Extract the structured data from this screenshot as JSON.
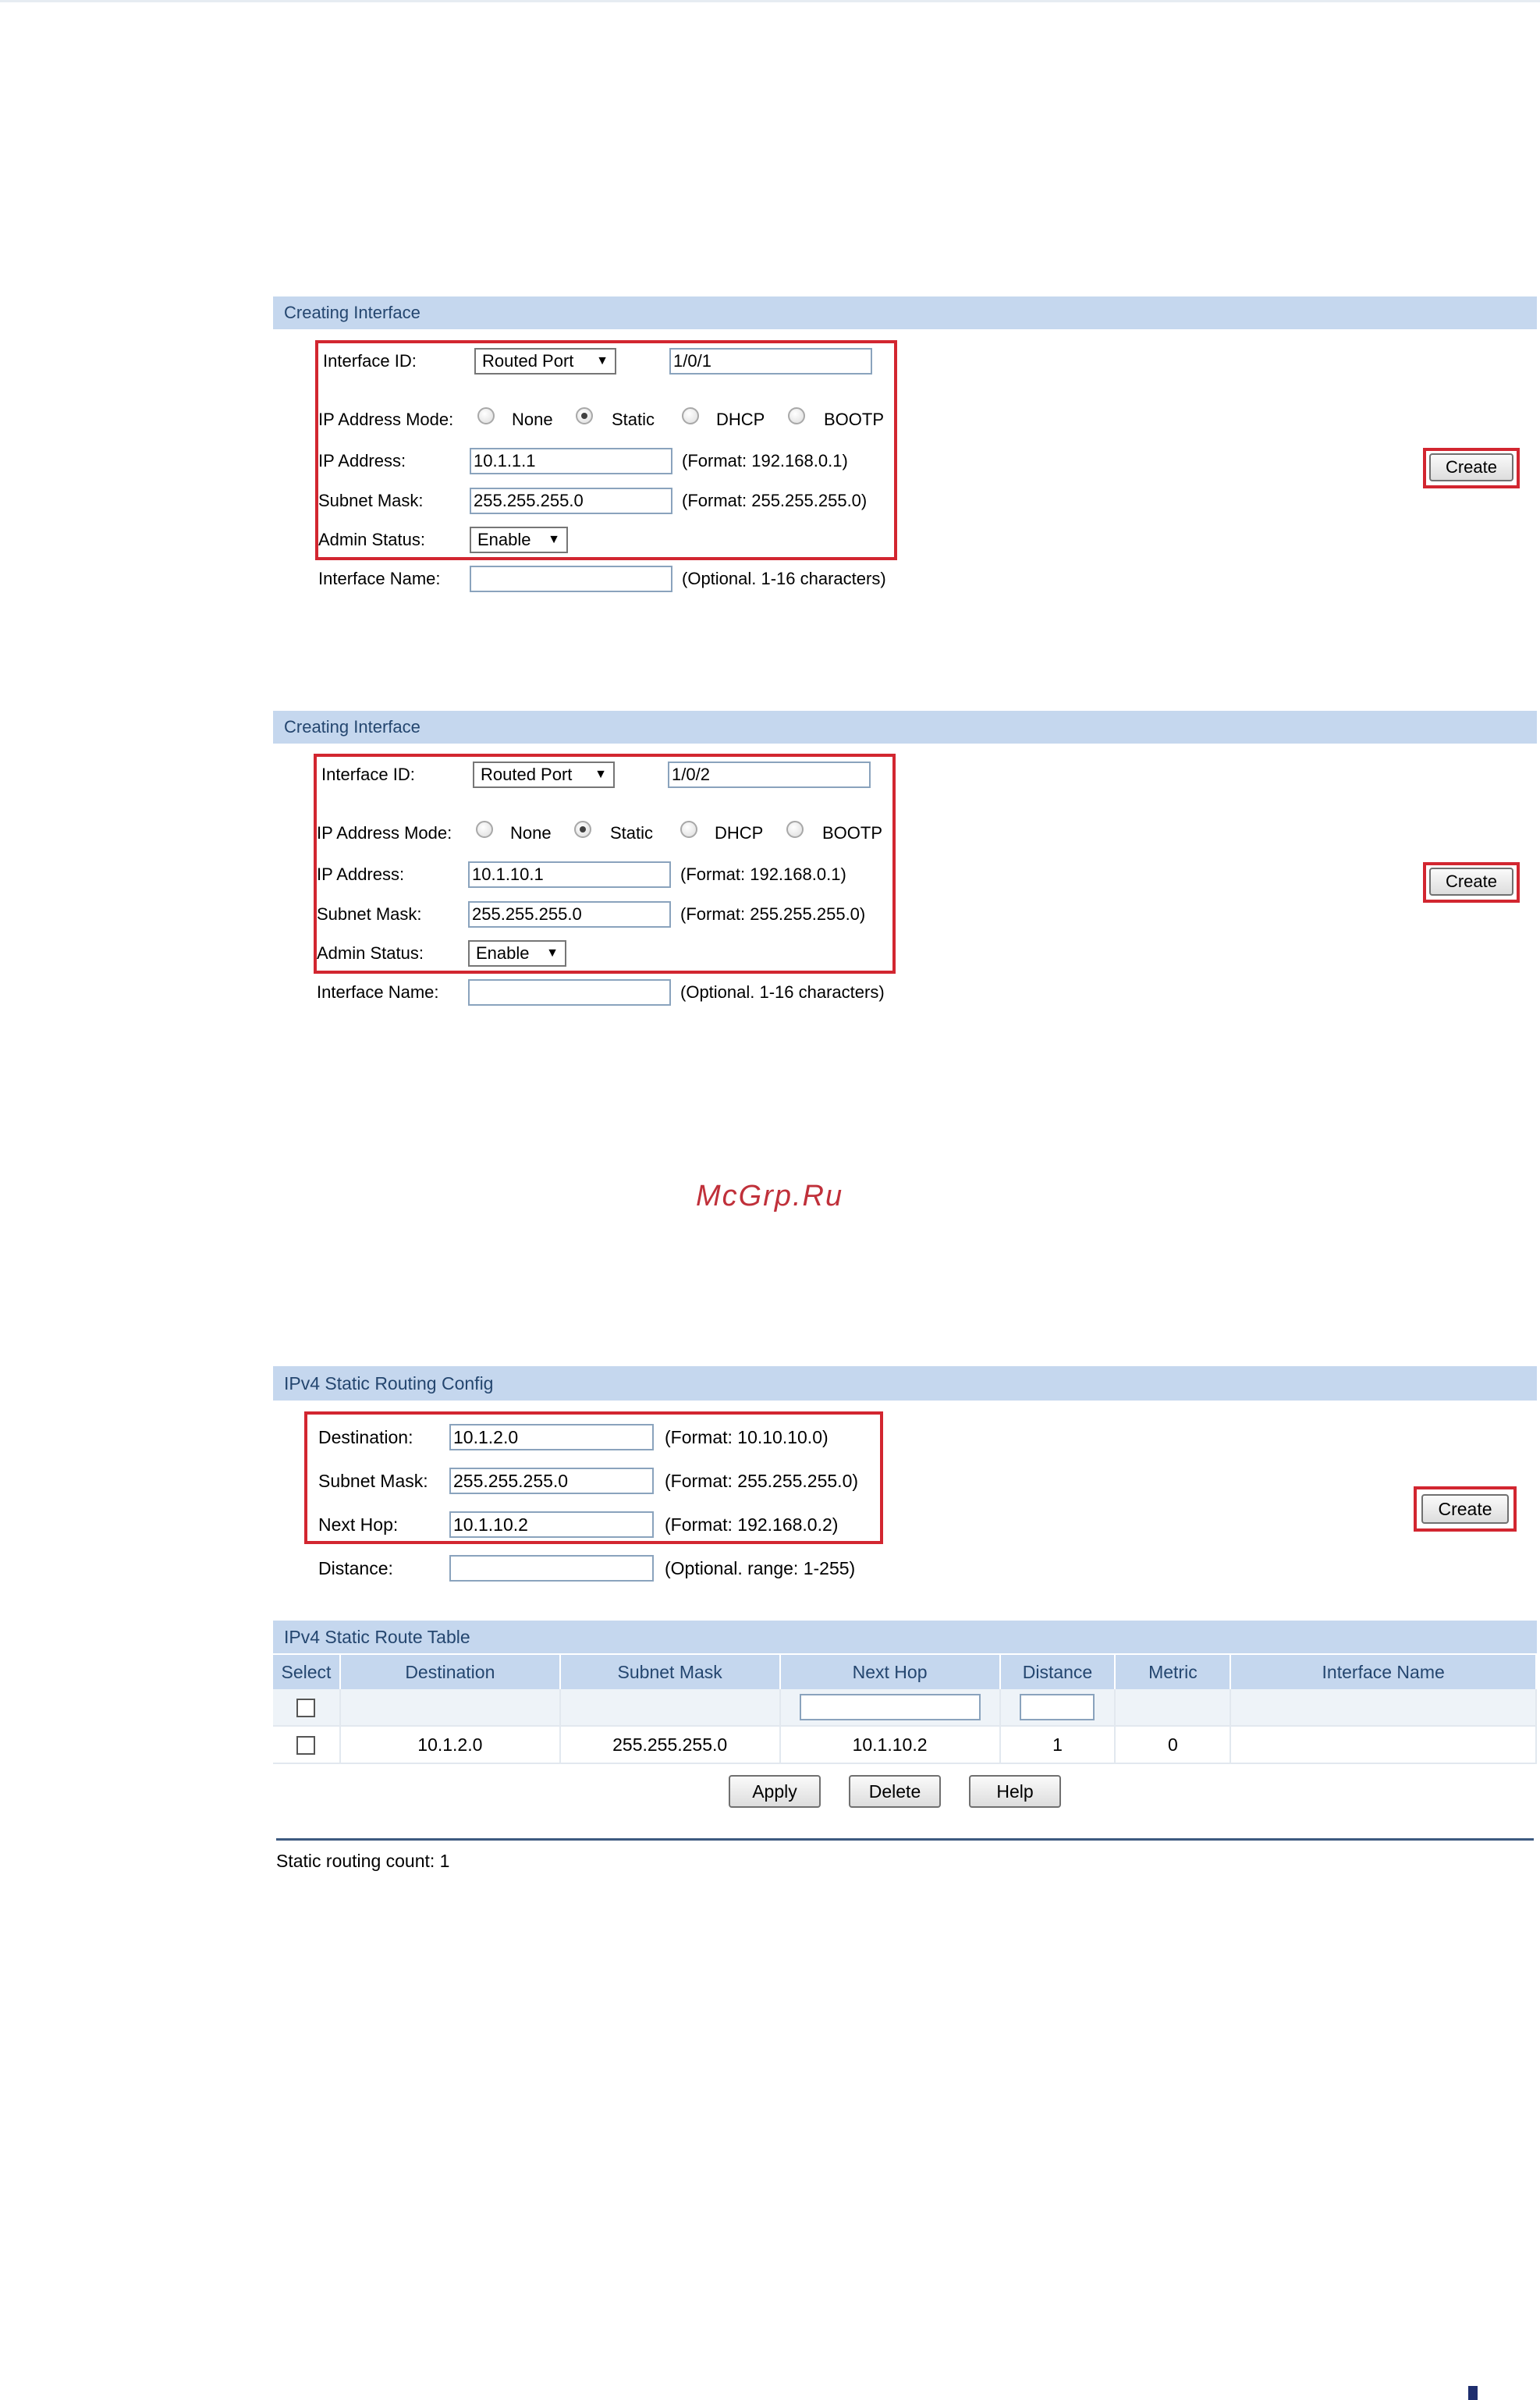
{
  "panel1": {
    "title": "Creating Interface",
    "interface_id_label": "Interface ID:",
    "interface_type": "Routed Port",
    "interface_id": "1/0/1",
    "ip_mode_label": "IP Address Mode:",
    "ip_modes": [
      "None",
      "Static",
      "DHCP",
      "BOOTP"
    ],
    "ip_mode_selected": "Static",
    "ip_label": "IP Address:",
    "ip_value": "10.1.1.1",
    "ip_hint": "(Format: 192.168.0.1)",
    "mask_label": "Subnet Mask:",
    "mask_value": "255.255.255.0",
    "mask_hint": "(Format: 255.255.255.0)",
    "admin_label": "Admin Status:",
    "admin_value": "Enable",
    "name_label": "Interface Name:",
    "name_value": "",
    "name_hint": "(Optional. 1-16 characters)",
    "create_label": "Create"
  },
  "panel2": {
    "title": "Creating Interface",
    "interface_id_label": "Interface ID:",
    "interface_type": "Routed Port",
    "interface_id": "1/0/2",
    "ip_mode_label": "IP Address Mode:",
    "ip_modes": [
      "None",
      "Static",
      "DHCP",
      "BOOTP"
    ],
    "ip_mode_selected": "Static",
    "ip_label": "IP Address:",
    "ip_value": "10.1.10.1",
    "ip_hint": "(Format: 192.168.0.1)",
    "mask_label": "Subnet Mask:",
    "mask_value": "255.255.255.0",
    "mask_hint": "(Format: 255.255.255.0)",
    "admin_label": "Admin Status:",
    "admin_value": "Enable",
    "name_label": "Interface Name:",
    "name_value": "",
    "name_hint": "(Optional. 1-16 characters)",
    "create_label": "Create"
  },
  "watermark": "McGrp.Ru",
  "routing": {
    "title": "IPv4 Static Routing Config",
    "dest_label": "Destination:",
    "dest_value": "10.1.2.0",
    "dest_hint": "(Format: 10.10.10.0)",
    "mask_label": "Subnet Mask:",
    "mask_value": "255.255.255.0",
    "mask_hint": "(Format: 255.255.255.0)",
    "nexthop_label": "Next Hop:",
    "nexthop_value": "10.1.10.2",
    "nexthop_hint": "(Format: 192.168.0.2)",
    "distance_label": "Distance:",
    "distance_value": "",
    "distance_hint": "(Optional. range: 1-255)",
    "create_label": "Create"
  },
  "route_table": {
    "title": "IPv4 Static Route Table",
    "columns": [
      "Select",
      "Destination",
      "Subnet Mask",
      "Next Hop",
      "Distance",
      "Metric",
      "Interface Name"
    ],
    "rows": [
      {
        "destination": "10.1.2.0",
        "subnet_mask": "255.255.255.0",
        "next_hop": "10.1.10.2",
        "distance": "1",
        "metric": "0",
        "interface_name": ""
      }
    ],
    "apply_label": "Apply",
    "delete_label": "Delete",
    "help_label": "Help",
    "count_text": "Static routing count: 1"
  }
}
